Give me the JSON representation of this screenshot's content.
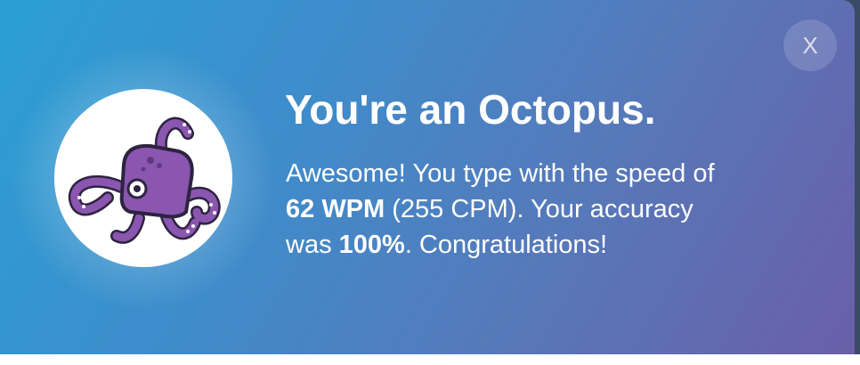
{
  "popup": {
    "title": "You're an Octopus.",
    "close_label": "X",
    "message": {
      "line1": "Awesome! You type with the speed of",
      "wpm": "62 WPM",
      "cpm": " (255 CPM). Your accuracy",
      "was": "was ",
      "accuracy": "100%",
      "end": ". Congratulations!"
    },
    "avatar_icon": "octopus-icon"
  },
  "colors": {
    "gradient_start": "#2a9fd3",
    "gradient_end": "#6a5fa8",
    "octopus": "#8a56b0",
    "outline": "#2e2340"
  }
}
